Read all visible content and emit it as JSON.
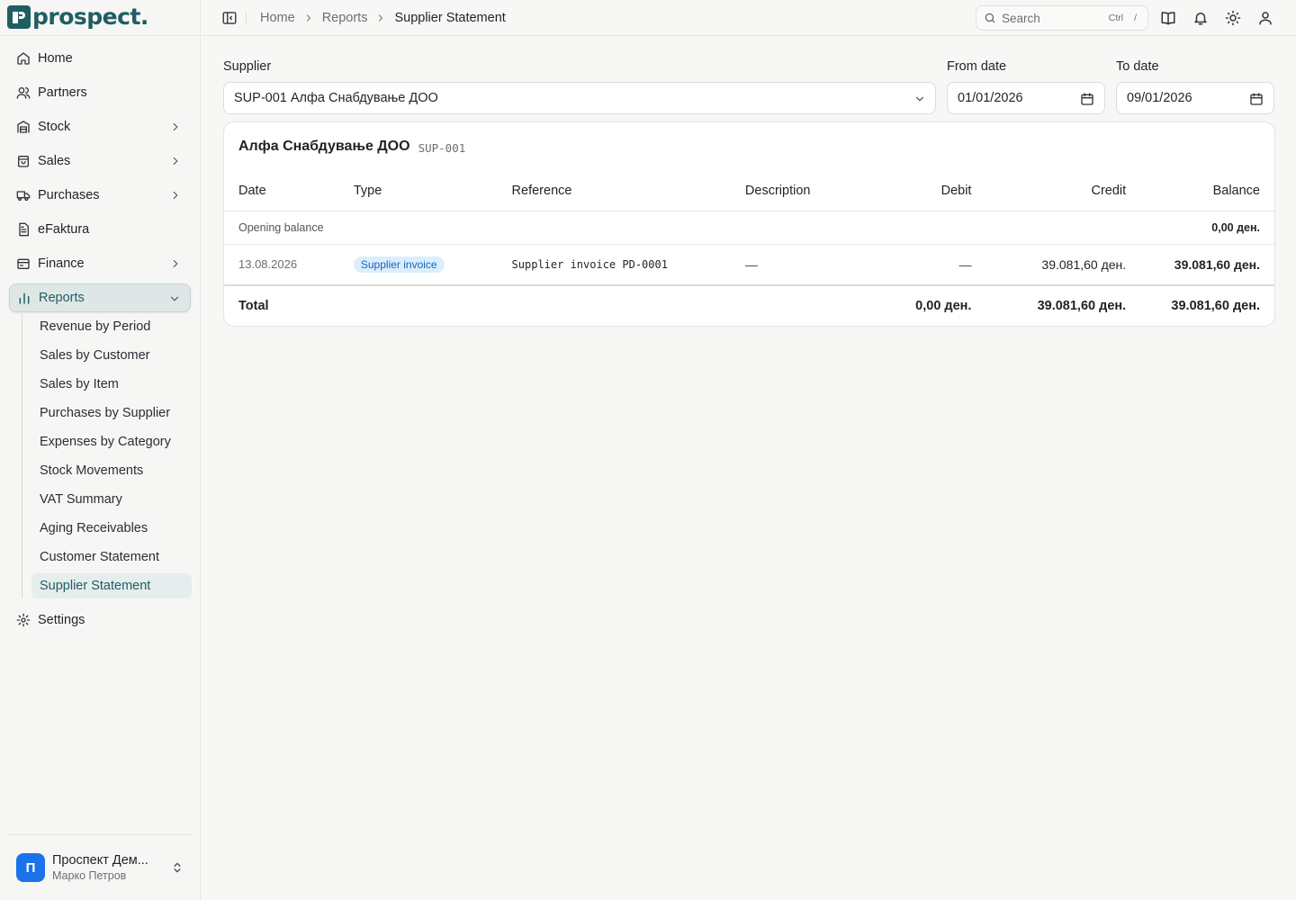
{
  "app": {
    "brand": "prospect."
  },
  "nav": {
    "home": "Home",
    "partners": "Partners",
    "stock": "Stock",
    "sales": "Sales",
    "purchases": "Purchases",
    "efaktura": "eFaktura",
    "finance": "Finance",
    "reports": "Reports",
    "settings": "Settings",
    "reports_sub": [
      "Revenue by Period",
      "Sales by Customer",
      "Sales by Item",
      "Purchases by Supplier",
      "Expenses by Category",
      "Stock Movements",
      "VAT Summary",
      "Aging Receivables",
      "Customer Statement",
      "Supplier Statement"
    ]
  },
  "org": {
    "initial": "П",
    "name": "Проспект Дем...",
    "user": "Марко Петров"
  },
  "breadcrumb": {
    "home": "Home",
    "reports": "Reports",
    "current": "Supplier Statement"
  },
  "search": {
    "placeholder": "Search",
    "kbd_ctrl": "Ctrl",
    "kbd_key": "/"
  },
  "filters": {
    "supplier_label": "Supplier",
    "supplier_value": "SUP-001 Алфа Снабдување ДОО",
    "from_label": "From date",
    "from_value": "01/01/2026",
    "to_label": "To date",
    "to_value": "09/01/2026"
  },
  "statement": {
    "title": "Алфа Снабдување ДОО",
    "code": "SUP-001",
    "columns": {
      "date": "Date",
      "type": "Type",
      "reference": "Reference",
      "description": "Description",
      "debit": "Debit",
      "credit": "Credit",
      "balance": "Balance"
    },
    "opening": {
      "label": "Opening balance",
      "balance": "0,00 ден."
    },
    "rows": [
      {
        "date": "13.08.2026",
        "type": "Supplier invoice",
        "reference": "Supplier invoice PD-0001",
        "description": "—",
        "debit": "—",
        "credit": "39.081,60 ден.",
        "balance": "39.081,60 ден."
      }
    ],
    "total": {
      "label": "Total",
      "debit": "0,00 ден.",
      "credit": "39.081,60 ден.",
      "balance": "39.081,60 ден."
    }
  },
  "colors": {
    "brand": "#1f5e63",
    "badge_bg": "#dbeefc",
    "badge_text": "#1565c0",
    "avatar": "#1a73e8"
  }
}
